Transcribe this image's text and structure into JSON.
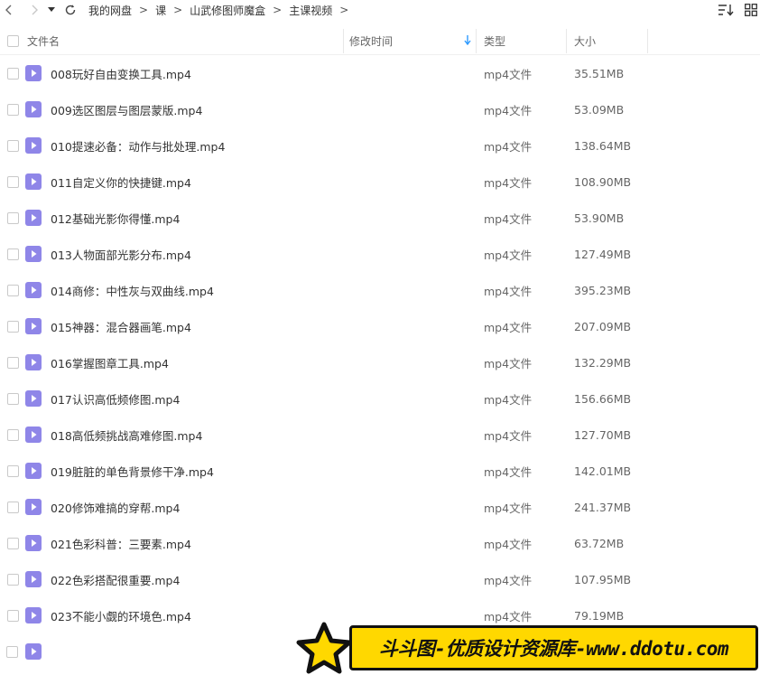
{
  "toolbar": {
    "breadcrumbs": [
      "我的网盘",
      "课",
      "山武修图师魔盒",
      "主课视频"
    ],
    "separator": ">"
  },
  "header": {
    "name": "文件名",
    "time": "修改时间",
    "type": "类型",
    "size": "大小"
  },
  "files": [
    {
      "name": "008玩好自由变换工具.mp4",
      "time": "",
      "type": "mp4文件",
      "size": "35.51MB"
    },
    {
      "name": "009选区图层与图层蒙版.mp4",
      "time": "",
      "type": "mp4文件",
      "size": "53.09MB"
    },
    {
      "name": "010提速必备：动作与批处理.mp4",
      "time": "",
      "type": "mp4文件",
      "size": "138.64MB"
    },
    {
      "name": "011自定义你的快捷键.mp4",
      "time": "",
      "type": "mp4文件",
      "size": "108.90MB"
    },
    {
      "name": "012基础光影你得懂.mp4",
      "time": "",
      "type": "mp4文件",
      "size": "53.90MB"
    },
    {
      "name": "013人物面部光影分布.mp4",
      "time": "",
      "type": "mp4文件",
      "size": "127.49MB"
    },
    {
      "name": "014商修：中性灰与双曲线.mp4",
      "time": "",
      "type": "mp4文件",
      "size": "395.23MB"
    },
    {
      "name": "015神器：混合器画笔.mp4",
      "time": "",
      "type": "mp4文件",
      "size": "207.09MB"
    },
    {
      "name": "016掌握图章工具.mp4",
      "time": "",
      "type": "mp4文件",
      "size": "132.29MB"
    },
    {
      "name": "017认识高低频修图.mp4",
      "time": "",
      "type": "mp4文件",
      "size": "156.66MB"
    },
    {
      "name": "018高低频挑战高难修图.mp4",
      "time": "",
      "type": "mp4文件",
      "size": "127.70MB"
    },
    {
      "name": "019脏脏的单色背景修干净.mp4",
      "time": "",
      "type": "mp4文件",
      "size": "142.01MB"
    },
    {
      "name": "020修饰难搞的穿帮.mp4",
      "time": "",
      "type": "mp4文件",
      "size": "241.37MB"
    },
    {
      "name": "021色彩科普：三要素.mp4",
      "time": "",
      "type": "mp4文件",
      "size": "63.72MB"
    },
    {
      "name": "022色彩搭配很重要.mp4",
      "time": "",
      "type": "mp4文件",
      "size": "107.95MB"
    },
    {
      "name": "023不能小觑的环境色.mp4",
      "time": "",
      "type": "mp4文件",
      "size": "79.19MB"
    }
  ],
  "banner": {
    "text": "斗斗图-优质设计资源库-www.ddotu.com"
  },
  "colors": {
    "file_icon": "#8f86e8",
    "sort_arrow": "#2f9bff",
    "banner_bg": "#ffd800"
  },
  "icons": {
    "back": "chevron-left-icon",
    "forward": "chevron-right-icon",
    "dropdown": "caret-down-icon",
    "refresh": "refresh-icon",
    "sort": "sort-icon",
    "grid": "grid-view-icon",
    "file": "video-file-icon",
    "star": "star-icon"
  }
}
